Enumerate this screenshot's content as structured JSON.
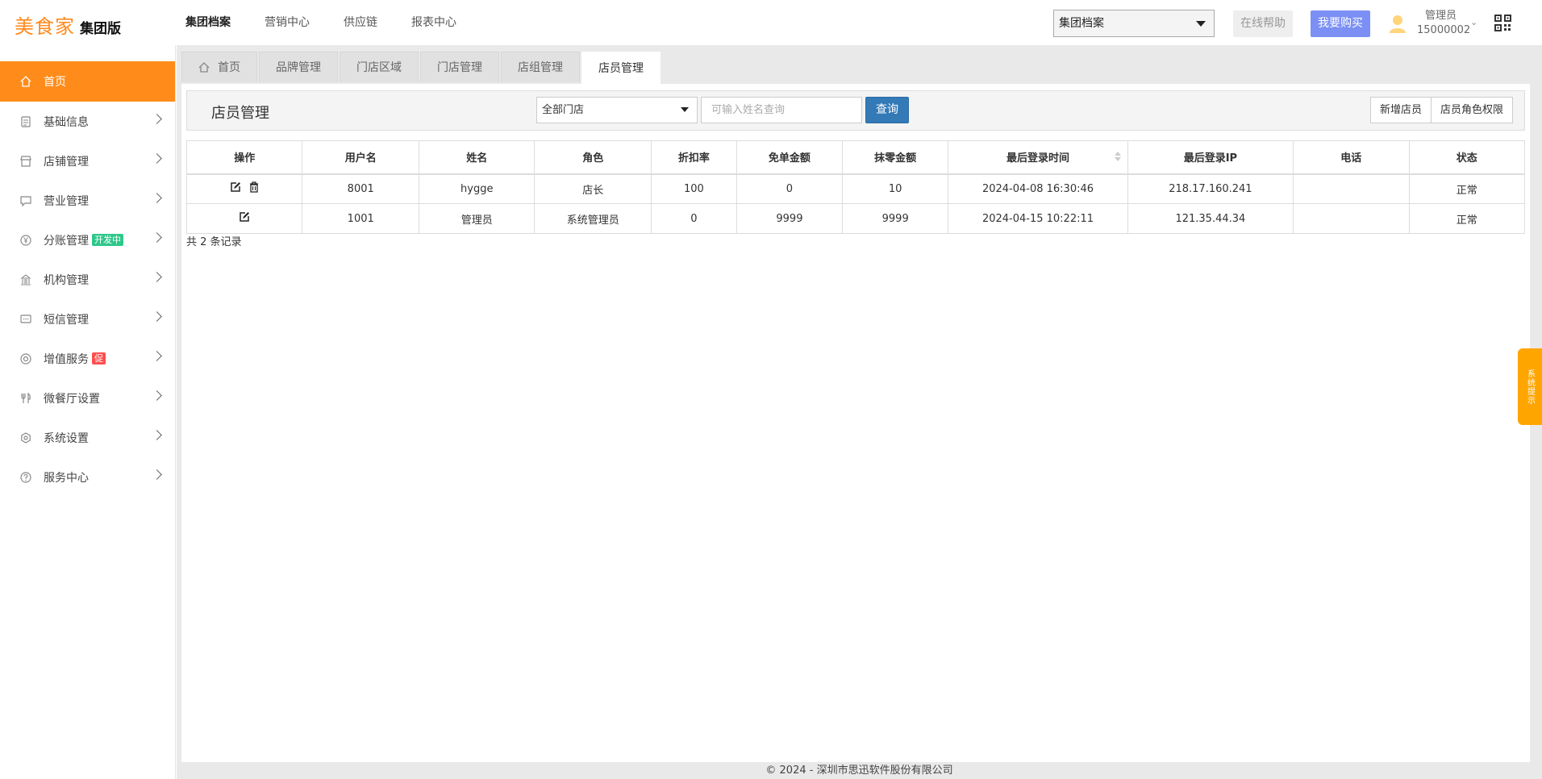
{
  "header": {
    "brand": "美食家",
    "edition": "集团版",
    "nav": [
      "集团档案",
      "营销中心",
      "供应链",
      "报表中心"
    ],
    "active_nav": "集团档案",
    "group_select": "集团档案",
    "help_label": "在线帮助",
    "buy_label": "我要购买",
    "user_role": "管理员",
    "user_id": "15000002"
  },
  "sidebar": {
    "items": [
      {
        "label": "首页",
        "icon": "home-icon"
      },
      {
        "label": "基础信息",
        "icon": "document-icon"
      },
      {
        "label": "店铺管理",
        "icon": "store-icon"
      },
      {
        "label": "营业管理",
        "icon": "chat-icon"
      },
      {
        "label": "分账管理",
        "icon": "yen-icon",
        "badge": "开发中"
      },
      {
        "label": "机构管理",
        "icon": "building-icon"
      },
      {
        "label": "短信管理",
        "icon": "message-icon"
      },
      {
        "label": "增值服务",
        "icon": "target-icon",
        "badge": "促"
      },
      {
        "label": "微餐厅设置",
        "icon": "utensils-icon"
      },
      {
        "label": "系统设置",
        "icon": "settings-icon"
      },
      {
        "label": "服务中心",
        "icon": "help-icon"
      }
    ]
  },
  "tabs": [
    "首页",
    "品牌管理",
    "门店区域",
    "门店管理",
    "店组管理",
    "店员管理"
  ],
  "toolbar": {
    "title": "店员管理",
    "store_select": "全部门店",
    "name_placeholder": "可输入姓名查询",
    "query_label": "查询",
    "add_label": "新增店员",
    "role_label": "店员角色权限"
  },
  "table": {
    "columns": [
      "操作",
      "用户名",
      "姓名",
      "角色",
      "折扣率",
      "免单金额",
      "抹零金额",
      "最后登录时间",
      "最后登录IP",
      "电话",
      "状态"
    ],
    "rows": [
      [
        "",
        "8001",
        "hygge",
        "店长",
        "100",
        "0",
        "10",
        "2024-04-08 16:30:46",
        "218.17.160.241",
        "",
        "正常"
      ],
      [
        "",
        "1001",
        "管理员",
        "系统管理员",
        "0",
        "9999",
        "9999",
        "2024-04-15 10:22:11",
        "121.35.44.34",
        "",
        "正常"
      ]
    ],
    "record_text": "共 2 条记录"
  },
  "footer": "© 2024 - 深圳市思迅软件股份有限公司",
  "side_notice": "系统提示",
  "colors": {
    "accent": "#ff8c1a",
    "primary": "#337ab7",
    "buy": "#7b8ff4"
  }
}
